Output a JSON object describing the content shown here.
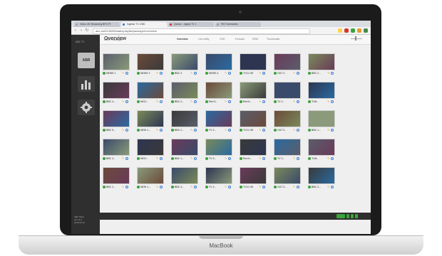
{
  "browser": {
    "tabs": [
      {
        "label": "Video 4K Streaming BFO Pi",
        "active": false,
        "fav": "grey"
      },
      {
        "label": "Ingesst TV 1080",
        "active": true,
        "fav": "blue"
      },
      {
        "label": "Queue - Ingest TV 1",
        "active": false,
        "fav": "red"
      },
      {
        "label": "PAT Schedules",
        "active": false,
        "fav": "grey"
      }
    ],
    "url": "abc-net02:8080/static/playlist/packager/overview"
  },
  "app": {
    "logo": "ABC TV",
    "title": "ABR Packager",
    "nav_tabs": [
      {
        "label": "Overview",
        "active": true
      },
      {
        "label": "Live utility",
        "active": false
      },
      {
        "label": "VOD",
        "active": false
      },
      {
        "label": "Formats",
        "active": false
      },
      {
        "label": "DRM",
        "active": false
      },
      {
        "label": "Thumbnails",
        "active": false
      }
    ],
    "sidebar": {
      "tiles": [
        {
          "label": "ABR",
          "kind": "text",
          "active": true
        },
        {
          "label": "",
          "kind": "bars-icon",
          "active": false
        },
        {
          "label": "",
          "kind": "gear-icon",
          "active": false
        }
      ],
      "footer": [
        "ABC Meta",
        "ver 12.4",
        "2015-02-11"
      ]
    },
    "page_title": "Overview",
    "thumbnails": [
      [
        {
          "caption": "NEWS 1",
          "status": "ok"
        },
        {
          "caption": "NEWS 2",
          "status": "ok"
        },
        {
          "caption": "BBC 3",
          "status": "ok"
        },
        {
          "caption": "NEWS 4",
          "status": "ok"
        },
        {
          "caption": "TV11 HD",
          "status": "ok"
        },
        {
          "caption": "OUT 2...",
          "status": "ok"
        },
        {
          "caption": "BBC 2...",
          "status": "ok"
        }
      ],
      [
        {
          "caption": "BBC 4...",
          "status": "ok"
        },
        {
          "caption": "NECI...",
          "status": "ok"
        },
        {
          "caption": "BBC 2...",
          "status": "ok"
        },
        {
          "caption": "Red 3...",
          "status": "ok"
        },
        {
          "caption": "Red 6...",
          "status": "ok"
        },
        {
          "caption": "TV 2...",
          "status": "ok"
        },
        {
          "caption": "TUN...",
          "status": "ok"
        }
      ],
      [
        {
          "caption": "BBC 5...",
          "status": "ok"
        },
        {
          "caption": "NEW 1...",
          "status": "ok"
        },
        {
          "caption": "BBC 2...",
          "status": "ok"
        },
        {
          "caption": "TV 2...",
          "status": "ok"
        },
        {
          "caption": "TV11 HD",
          "status": "ok"
        },
        {
          "caption": "OUT 2...",
          "status": "ok"
        },
        {
          "caption": "BBC 1...",
          "status": "ok"
        }
      ],
      [
        {
          "caption": "BBC 4...",
          "status": "ok"
        },
        {
          "caption": "NECI...",
          "status": "ok"
        },
        {
          "caption": "BBC 1...",
          "status": "ok"
        },
        {
          "caption": "TV 3...",
          "status": "ok"
        },
        {
          "caption": "Red 6...",
          "status": "ok"
        },
        {
          "caption": "TV 2...",
          "status": "ok"
        },
        {
          "caption": "TUN...",
          "status": "ok"
        }
      ],
      [
        {
          "caption": "BBC 2...",
          "status": "ok"
        },
        {
          "caption": "NEW 1...",
          "status": "ok"
        },
        {
          "caption": "BBC 3...",
          "status": "ok"
        },
        {
          "caption": "TV 2...",
          "status": "ok"
        },
        {
          "caption": "TV11 HD",
          "status": "ok"
        },
        {
          "caption": "OUT 2...",
          "status": "ok"
        },
        {
          "caption": "BBC 2...",
          "status": "ok"
        }
      ]
    ]
  },
  "device": {
    "brand": "MacBook"
  },
  "colors": {
    "status_ok": "#3aa33a",
    "edit": "#e39b2a",
    "sync": "#3a7bd5",
    "thumb_palette": [
      "#5a5d6b",
      "#6b4a3a",
      "#8a9a7a",
      "#3a4a6a",
      "#2d3550",
      "#6a3a5a",
      "#7a8a5a",
      "#3a3a3a",
      "#2a6aa0"
    ]
  }
}
